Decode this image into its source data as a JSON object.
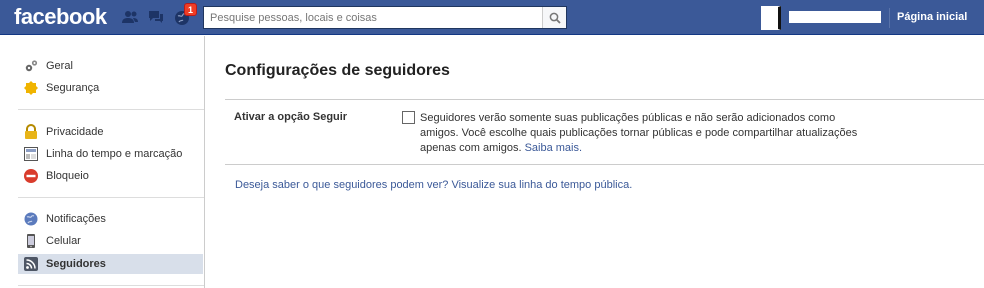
{
  "header": {
    "logo": "facebook",
    "notification_count": "1",
    "search_placeholder": "Pesquise pessoas, locais e coisas",
    "home_label": "Página inicial"
  },
  "sidebar": {
    "groups": [
      [
        {
          "label": "Geral",
          "icon": "gears-icon"
        },
        {
          "label": "Segurança",
          "icon": "badge-icon"
        }
      ],
      [
        {
          "label": "Privacidade",
          "icon": "lock-icon"
        },
        {
          "label": "Linha do tempo e marcação",
          "icon": "timeline-icon"
        },
        {
          "label": "Bloqueio",
          "icon": "block-icon"
        }
      ],
      [
        {
          "label": "Notificações",
          "icon": "globe-icon"
        },
        {
          "label": "Celular",
          "icon": "phone-icon"
        },
        {
          "label": "Seguidores",
          "icon": "rss-icon",
          "active": true
        }
      ]
    ]
  },
  "main": {
    "title": "Configurações de seguidores",
    "setting_label": "Ativar a opção Seguir",
    "setting_checked": false,
    "setting_description": "Seguidores verão somente suas publicações públicas e não serão adicionados como amigos. Você escolhe quais publicações tornar públicas e pode compartilhar atualizações apenas com amigos.",
    "learn_more": "Saiba mais.",
    "bottom_link": "Deseja saber o que seguidores podem ver? Visualize sua linha do tempo pública."
  },
  "colors": {
    "brand": "#3b5998",
    "active_item": "#d8dfea",
    "badge": "#f03d25"
  }
}
